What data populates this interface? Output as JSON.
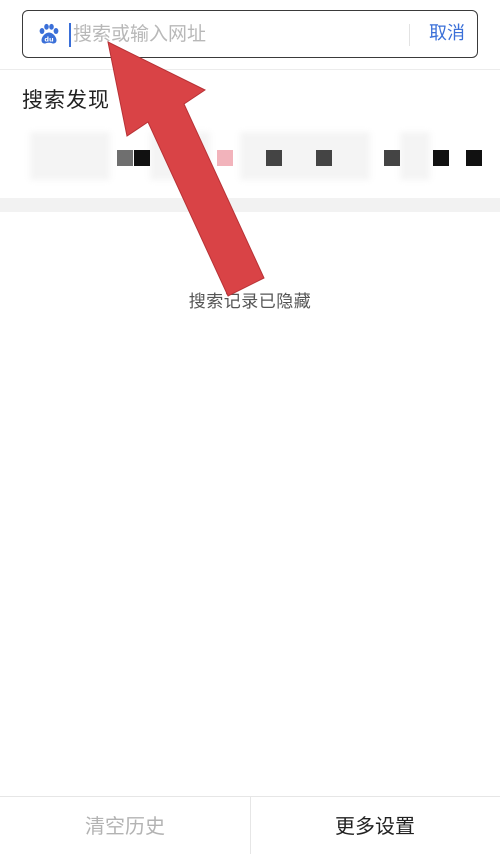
{
  "search": {
    "placeholder": "搜索或输入网址",
    "value": "",
    "cancel_label": "取消",
    "logo_icon": "baidu-paw-icon",
    "logo_color": "#3a6fd8"
  },
  "discover": {
    "title": "搜索发现"
  },
  "history": {
    "status": "搜索记录已隐藏"
  },
  "bottom": {
    "clear_label": "清空历史",
    "more_label": "更多设置"
  },
  "overlay": {
    "arrow_color": "#d94346",
    "arrow_icon": "red-annotation-arrow"
  }
}
